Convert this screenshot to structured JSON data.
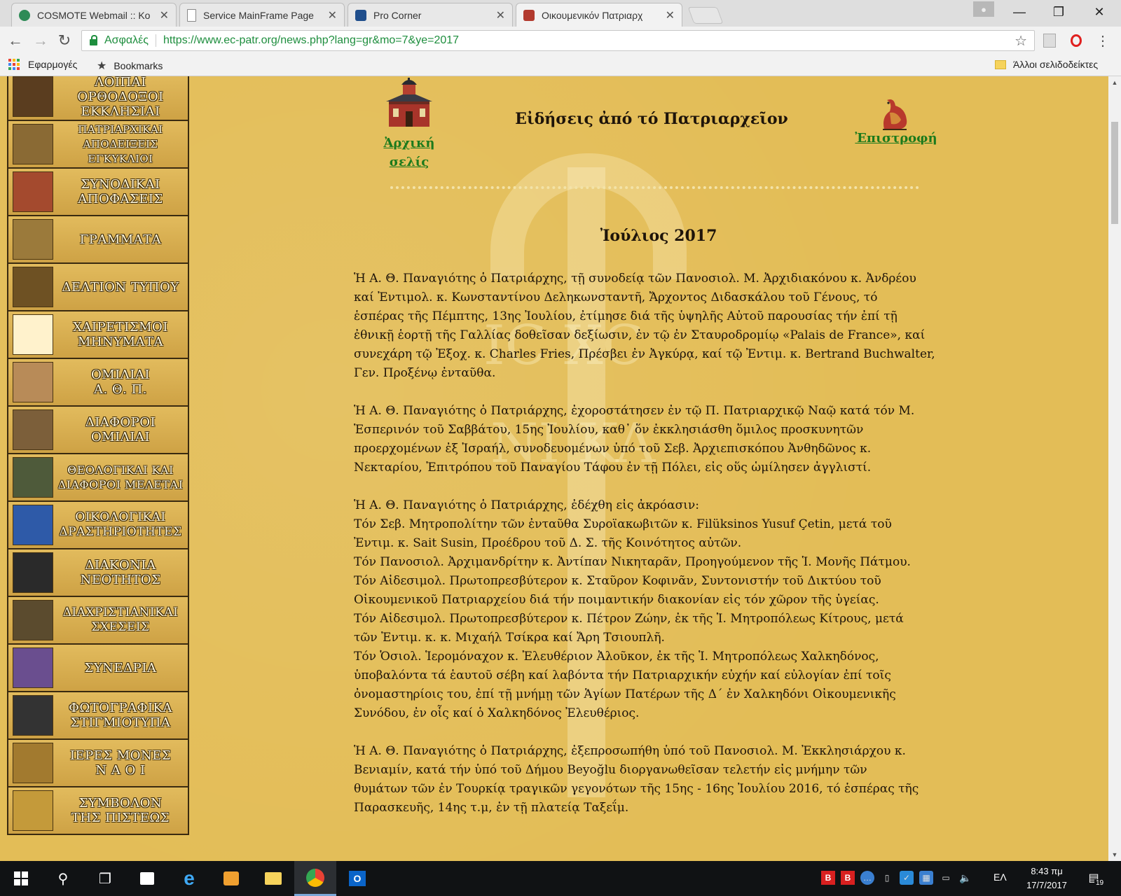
{
  "browser": {
    "tabs": [
      {
        "title": "COSMOTE Webmail :: Κο",
        "favicon_color": "#2e8b57"
      },
      {
        "title": "Service MainFrame Page",
        "favicon_color": "#ffffff"
      },
      {
        "title": "Pro Corner",
        "favicon_color": "#1f4e8c"
      },
      {
        "title": "Οικουμενικόν Πατριαρχ",
        "favicon_color": "#b23a2e"
      }
    ],
    "active_tab_index": 3,
    "secure_label": "Ασφαλές",
    "url": "https://www.ec-patr.org/news.php?lang=gr&mo=7&ye=2017",
    "bookmarks": {
      "apps": "Εφαρμογές",
      "bookmarks": "Bookmarks",
      "other": "Άλλοι σελιδοδείκτες"
    }
  },
  "sidebar": {
    "items": [
      {
        "label": "ΛΟΙΠΑΙ ΟΡΘΟΔΟΞΟΙ\nΕΚΚΛΗΣΙΑΙ"
      },
      {
        "label": "ΠΑΤΡΙΑΡΧΙΚΑΙ ΑΠΟΔΕΙΞΕΙΣ\nΕΓΚΥΚΛΙΟΙ"
      },
      {
        "label": "ΣΥΝΟΔΙΚΑΙ\nΑΠΟΦΑΣΕΙΣ"
      },
      {
        "label": "ΓΡΑΜΜΑΤΑ"
      },
      {
        "label": "ΔΕΛΤΙΟΝ ΤΥΠΟΥ"
      },
      {
        "label": "ΧΑΙΡΕΤΙΣΜΟΙ\nΜΗΝΥΜΑΤΑ"
      },
      {
        "label": "ΟΜΙΛΙΑΙ\nΑ. Θ. Π."
      },
      {
        "label": "ΔΙΑΦΟΡΟΙ\nΟΜΙΛΙΑΙ"
      },
      {
        "label": "ΘΕΟΛΟΓΙΚΑΙ ΚΑΙ\nΔΙΑΦΟΡΟΙ ΜΕΛΕΤΑΙ"
      },
      {
        "label": "ΟΙΚΟΛΟΓΙΚΑΙ\nΔΡΑΣΤΗΡΙΟΤΗΤΕΣ"
      },
      {
        "label": "ΔΙΑΚΟΝΙΑ\nΝΕΟΤΗΤΟΣ"
      },
      {
        "label": "ΔΙΑΧΡΙΣΤΙΑΝΙΚΑΙ\nΣΧΕΣΕΙΣ"
      },
      {
        "label": "ΣΥΝΕΔΡΙΑ"
      },
      {
        "label": "ΦΩΤΟΓΡΑΦΙΚΑ\nΣΤΙΓΜΙΟΤΥΠΑ"
      },
      {
        "label": "ΙΕΡΕΣ ΜΟΝΕΣ\nΝ Α Ο Ι"
      },
      {
        "label": "ΣΥΜΒΟΛΟΝ\nΤΗΣ ΠΙΣΤΕΩΣ"
      }
    ]
  },
  "header": {
    "home_line1": "Ἀρχική",
    "home_line2": "σελίς",
    "title": "Εἰδήσεις ἀπό τό Πατριαρχεῖον",
    "back": "Ἐπιστροφή"
  },
  "main": {
    "month": "Ἰούλιος 2017",
    "paragraphs": [
      [
        "Ἡ Α. Θ. Παναγιότης ὁ Πατριάρχης, τῇ συνοδείᾳ τῶν Πανοσιολ. Μ. Ἀρχιδιακόνου κ. Ἀνδρέου",
        "καί Ἐντιμολ. κ. Κωνσταντίνου Δεληκωνσταντῆ, Ἄρχοντος Διδασκάλου τοῦ Γένους, τό",
        "ἑσπέρας τῆς Πέμπτης, 13ης Ἰουλίου, ἐτίμησε διά τῆς ὑψηλῆς Αὐτοῦ παρουσίας τήν ἐπί τῇ",
        "ἐθνικῇ ἑορτῇ τῆς Γαλλίας δοθεῖσαν δεξίωσιν, ἐν τῷ ἐν Σταυροδρομίῳ «Palais de France», καί",
        "συνεχάρη τῷ Ἐξοχ. κ. Charles Fries, Πρέσβει ἐν Ἀγκύρᾳ, καί τῷ Ἐντιμ. κ. Bertrand Buchwalter,",
        "Γεν. Προξένῳ ἐνταῦθα."
      ],
      [
        "Ἡ Α. Θ. Παναγιότης ὁ Πατριάρχης, ἐχοροστάτησεν ἐν τῷ Π. Πατριαρχικῷ Ναῷ κατά τόν Μ.",
        "Ἑσπερινόν τοῦ Σαββάτου, 15ης Ἰουλίου, καθ᾽ ὅν ἐκκλησιάσθη ὅμιλος προσκυνητῶν",
        "προερχομένων ἐξ Ἰσραήλ, συνοδευομένων ὑπό τοῦ Σεβ. Ἀρχιεπισκόπου Ἀνθηδῶνος κ.",
        "Νεκταρίου, Ἐπιτρόπου τοῦ Παναγίου Τάφου ἐν τῇ Πόλει, εἰς οὕς ὡμίλησεν ἀγγλιστί."
      ],
      [
        "Ἡ Α. Θ. Παναγιότης ὁ Πατριάρχης, ἐδέχθη εἰς ἀκρόασιν:",
        "Τόν Σεβ. Μητροπολίτην τῶν ἐνταῦθα Συροϊακωβιτῶν κ. Filüksinos Yusuf Çetin, μετά τοῦ",
        "Ἐντιμ. κ. Sait Susin, Προέδρου τοῦ Δ. Σ. τῆς Κοινότητος αὐτῶν.",
        "Τόν Πανοσιολ. Ἀρχιμανδρίτην κ. Ἀντίπαν Νικηταρᾶν, Προηγούμενον τῆς Ἱ. Μονῆς Πάτμου.",
        "Τόν Αἰδεσιμολ. Πρωτοπρεσβύτερον κ. Σταῦρον Κοφινᾶν, Συντονιστήν τοῦ Δικτύου τοῦ",
        "Οἰκουμενικοῦ Πατριαρχείου διά τήν ποιμαντικήν διακονίαν εἰς τόν χῶρον τῆς ὑγείας.",
        "Τόν Αἰδεσιμολ. Πρωτοπρεσβύτερον κ. Πέτρον Ζώην, ἐκ τῆς Ἱ. Μητροπόλεως Κίτρους, μετά",
        "τῶν Ἐντιμ. κ. κ. Μιχαήλ Τσίκρα καί Ἄρη Τσιουπλῆ.",
        "Τόν Ὁσιολ. Ἱερομόναχον κ. Ἐλευθέριον Ἀλοῦκον, ἐκ τῆς Ἱ. Μητροπόλεως Χαλκηδόνος,",
        "ὑποβαλόντα τά ἑαυτοῦ σέβη καί λαβόντα τήν Πατριαρχικήν εὐχήν καί εὐλογίαν ἐπί τοῖς",
        "ὀνομαστηρίοις του, ἐπί τῇ μνήμῃ τῶν Ἁγίων Πατέρων τῆς Δ΄ ἐν Χαλκηδόνι Οἰκουμενικῆς",
        "Συνόδου, ἐν οἷς καί ὁ Χαλκηδόνος Ἐλευθέριος."
      ],
      [
        "Ἡ Α. Θ. Παναγιότης ὁ Πατριάρχης, ἐξεπροσωπήθη ὑπό τοῦ Πανοσιολ. Μ. Ἐκκλησιάρχου κ.",
        "Βενιαμίν, κατά τήν ὑπό τοῦ Δήμου Beyoğlu διοργανωθεῖσαν τελετήν εἰς μνήμην τῶν",
        "θυμάτων τῶν ἐν Τουρκίᾳ τραγικῶν γεγονότων τῆς 15ης - 16ης Ἰουλίου 2016, τό ἑσπέρας τῆς",
        "Παρασκευῆς, 14ης τ.μ, ἐν τῇ πλατείᾳ Ταξεΐμ."
      ]
    ]
  },
  "watermark": {
    "letters_top": "IC XC",
    "letters_mid": "NI KA"
  },
  "taskbar": {
    "time": "8:43 πμ",
    "date": "17/7/2017",
    "lang": "ΕΛ",
    "notifications": "19"
  }
}
